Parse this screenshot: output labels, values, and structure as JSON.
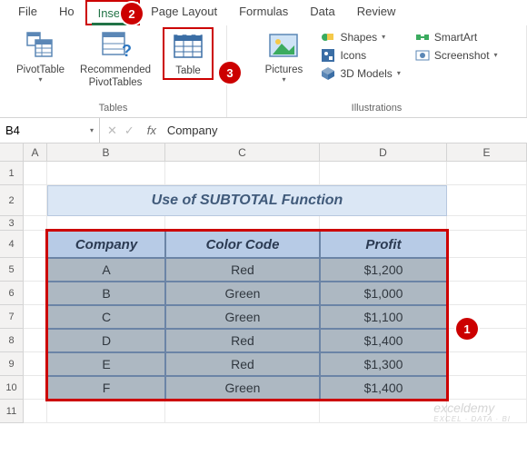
{
  "menu": {
    "file": "File",
    "home": "Ho",
    "insert": "Insert",
    "page_layout": "Page Layout",
    "formulas": "Formulas",
    "data": "Data",
    "review": "Review"
  },
  "ribbon": {
    "tables_label": "Tables",
    "illustrations_label": "Illustrations",
    "pivot": "PivotTable",
    "rec_pivot": "Recommended\nPivotTables",
    "table": "Table",
    "pictures": "Pictures",
    "shapes": "Shapes",
    "icons": "Icons",
    "models": "3D Models",
    "smartart": "SmartArt",
    "screenshot": "Screenshot"
  },
  "fx": {
    "namebox": "B4",
    "formula": "Company"
  },
  "cols": {
    "A": "A",
    "B": "B",
    "C": "C",
    "D": "D",
    "E": "E"
  },
  "rows": [
    "1",
    "2",
    "3",
    "4",
    "5",
    "6",
    "7",
    "8",
    "9",
    "10",
    "11"
  ],
  "title": "Use of SUBTOTAL Function",
  "table": {
    "headers": {
      "company": "Company",
      "color": "Color Code",
      "profit": "Profit"
    },
    "rows": [
      {
        "company": "A",
        "color": "Red",
        "profit": "$1,200"
      },
      {
        "company": "B",
        "color": "Green",
        "profit": "$1,000"
      },
      {
        "company": "C",
        "color": "Green",
        "profit": "$1,100"
      },
      {
        "company": "D",
        "color": "Red",
        "profit": "$1,400"
      },
      {
        "company": "E",
        "color": "Red",
        "profit": "$1,300"
      },
      {
        "company": "F",
        "color": "Green",
        "profit": "$1,400"
      }
    ]
  },
  "callouts": {
    "c1": "1",
    "c2": "2",
    "c3": "3"
  },
  "watermark": {
    "main": "exceldemy",
    "sub": "EXCEL · DATA · BI"
  }
}
